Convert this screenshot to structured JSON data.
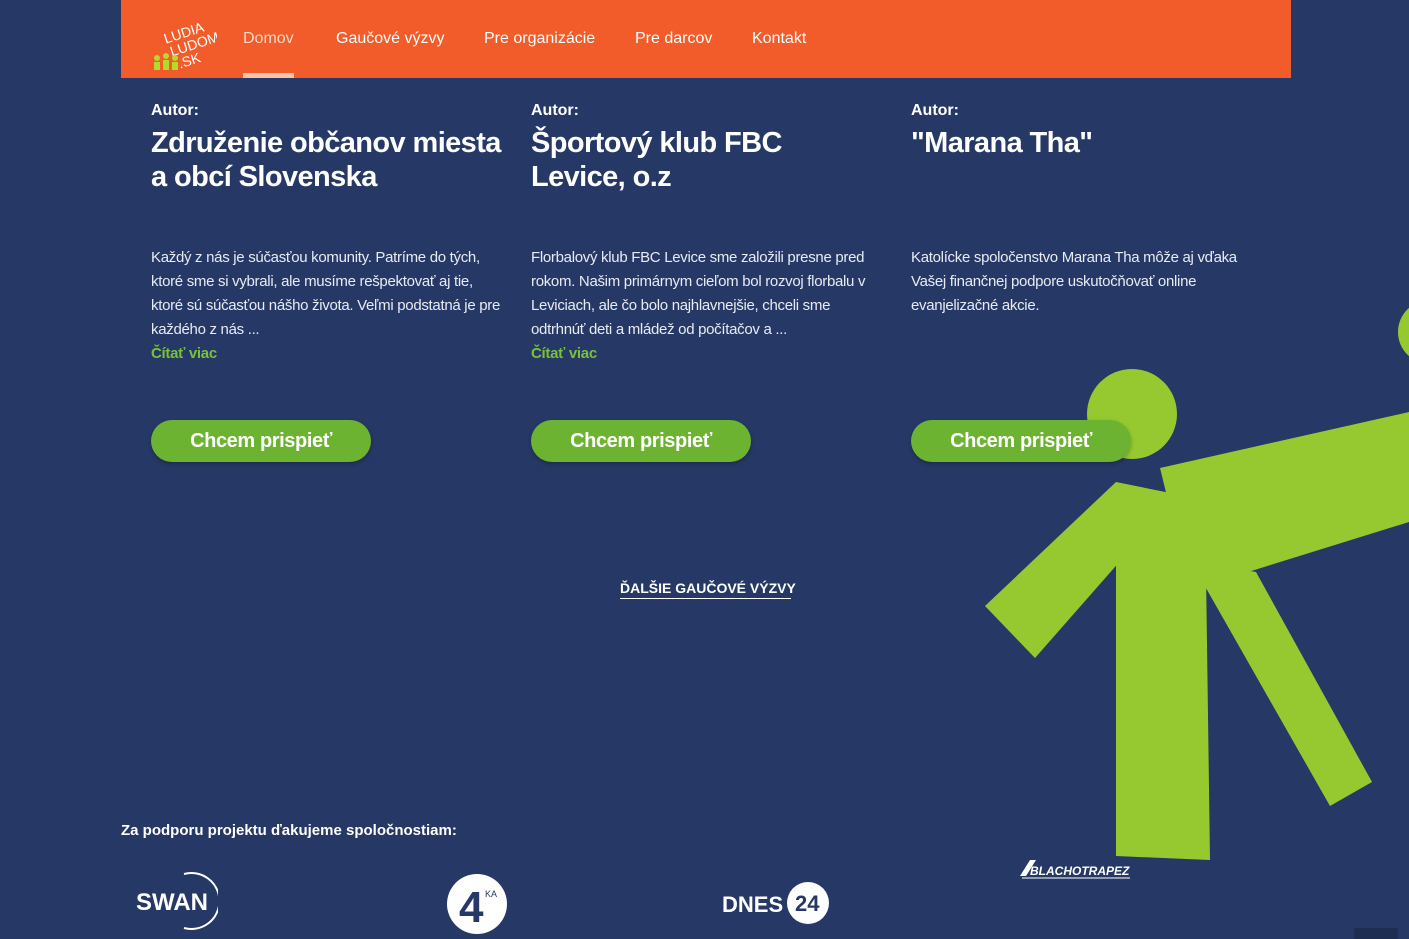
{
  "nav": {
    "logo_lines": [
      "LUDIA",
      "LUDOM",
      ".SK"
    ],
    "items": [
      "Domov",
      "Gaučové výzvy",
      "Pre organizácie",
      "Pre darcov",
      "Kontakt"
    ],
    "active": "Domov"
  },
  "cards": [
    {
      "author_label": "Autor:",
      "title": "Združenie občanov miesta a obcí Slovenska",
      "description": "Každý z nás je súčasťou komunity. Patríme do tých, ktoré sme si vybrali, ale musíme rešpektovať aj tie, ktoré sú súčasťou nášho života. Veľmi podstatná je pre každého z nás ...",
      "read_more": "Čítať viac",
      "button": "Chcem prispieť"
    },
    {
      "author_label": "Autor:",
      "title": "Športový klub FBC Levice, o.z",
      "description": "Florbalový klub FBC Levice sme založili presne pred rokom. Našim primárnym cieľom bol rozvoj florbalu v Leviciach, ale čo bolo najhlavnejšie, chceli sme odtrhnúť deti a mládež od počítačov a ...",
      "read_more": "Čítať viac",
      "button": "Chcem prispieť"
    },
    {
      "author_label": "Autor:",
      "title": "\"Marana Tha\"",
      "description": "Katolícke spoločenstvo Marana Tha môže aj vďaka Vašej finančnej podpore uskutočňovať online evanjelizačné akcie.",
      "read_more": "",
      "button": "Chcem prispieť"
    }
  ],
  "more_challenges": "ĎALŠIE GAUČOVÉ VÝZVY",
  "sponsors": {
    "title": "Za podporu projektu ďakujeme spoločnostiam:",
    "logos": [
      {
        "name": "swan-logo",
        "text": "SWAN"
      },
      {
        "name": "jojka-logo",
        "text": "4",
        "superscript": "KA"
      },
      {
        "name": "dnes24-logo",
        "text": "DNES",
        "badge": "24"
      },
      {
        "name": "blachotrapez-logo",
        "text": "BLACHOTRAPEZ"
      }
    ]
  },
  "colors": {
    "background": "#263865",
    "nav": "#f25c2a",
    "accent_green": "#6db332",
    "figure_green": "#96c92f"
  }
}
